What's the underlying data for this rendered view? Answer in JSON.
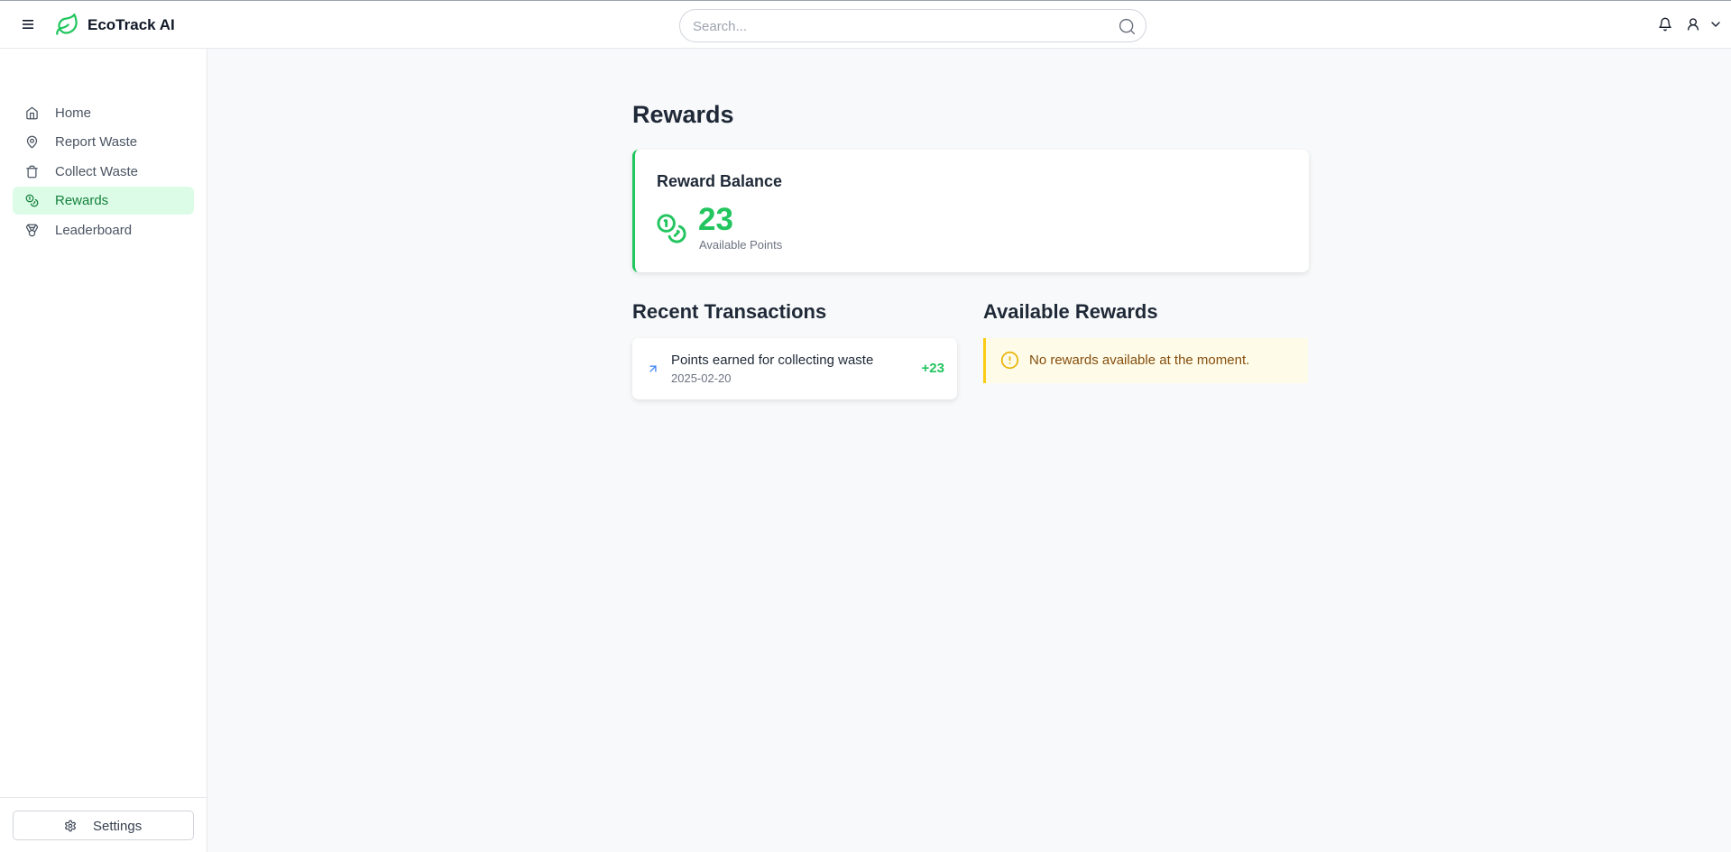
{
  "header": {
    "app_name": "EcoTrack AI",
    "search_placeholder": "Search..."
  },
  "sidebar": {
    "items": [
      {
        "label": "Home",
        "icon": "home-icon"
      },
      {
        "label": "Report Waste",
        "icon": "map-pin-icon"
      },
      {
        "label": "Collect Waste",
        "icon": "trash-icon"
      },
      {
        "label": "Rewards",
        "icon": "coins-icon",
        "active": true
      },
      {
        "label": "Leaderboard",
        "icon": "medal-icon"
      }
    ],
    "settings_label": "Settings"
  },
  "main": {
    "page_title": "Rewards",
    "balance": {
      "title": "Reward Balance",
      "value": "23",
      "subtitle": "Available Points"
    },
    "transactions": {
      "title": "Recent Transactions",
      "items": [
        {
          "description": "Points earned for collecting waste",
          "date": "2025-02-20",
          "amount": "+23"
        }
      ]
    },
    "available_rewards": {
      "title": "Available Rewards",
      "empty_message": "No rewards available at the moment."
    }
  },
  "colors": {
    "accent": "#22c55e",
    "active_bg": "#dcfce7",
    "warning_border": "#facc15",
    "warning_bg": "#fefce8"
  }
}
